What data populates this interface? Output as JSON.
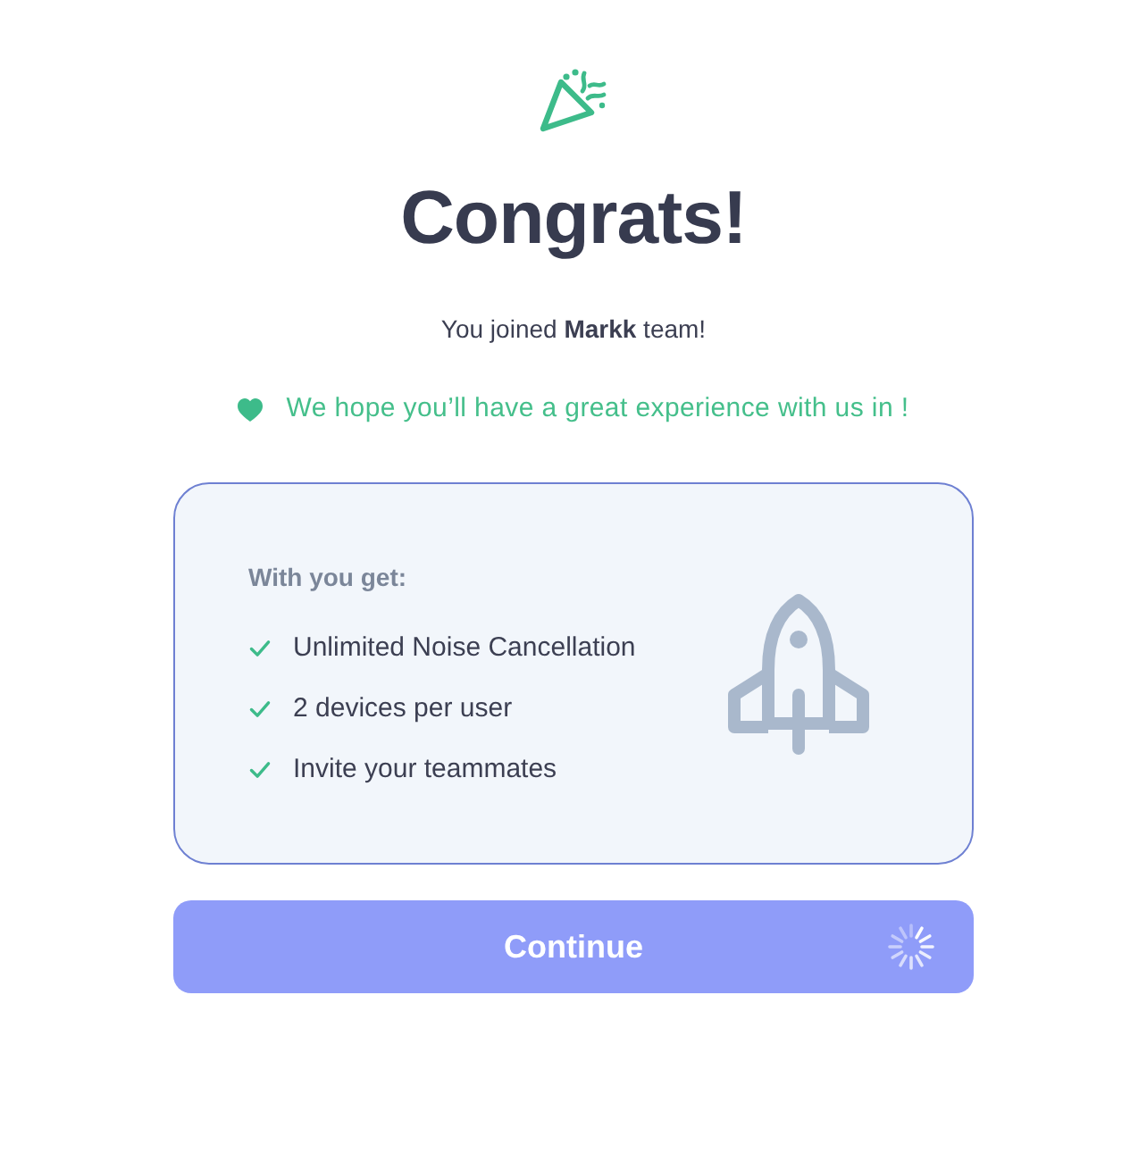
{
  "header": {
    "title": "Congrats!"
  },
  "joined_message": "You joined **Markk** team!",
  "hope_message": "We hope you’ll have a great experience with us in !",
  "benefits": {
    "title": "With you get:",
    "items": [
      {
        "label": "Unlimited Noise Cancellation",
        "checked": true
      },
      {
        "label": "2 devices per user",
        "checked": true
      },
      {
        "label": "Invite your teammates",
        "checked": true
      }
    ]
  },
  "continue_button": {
    "label": "Continue",
    "disabled": true,
    "loading": true
  }
}
